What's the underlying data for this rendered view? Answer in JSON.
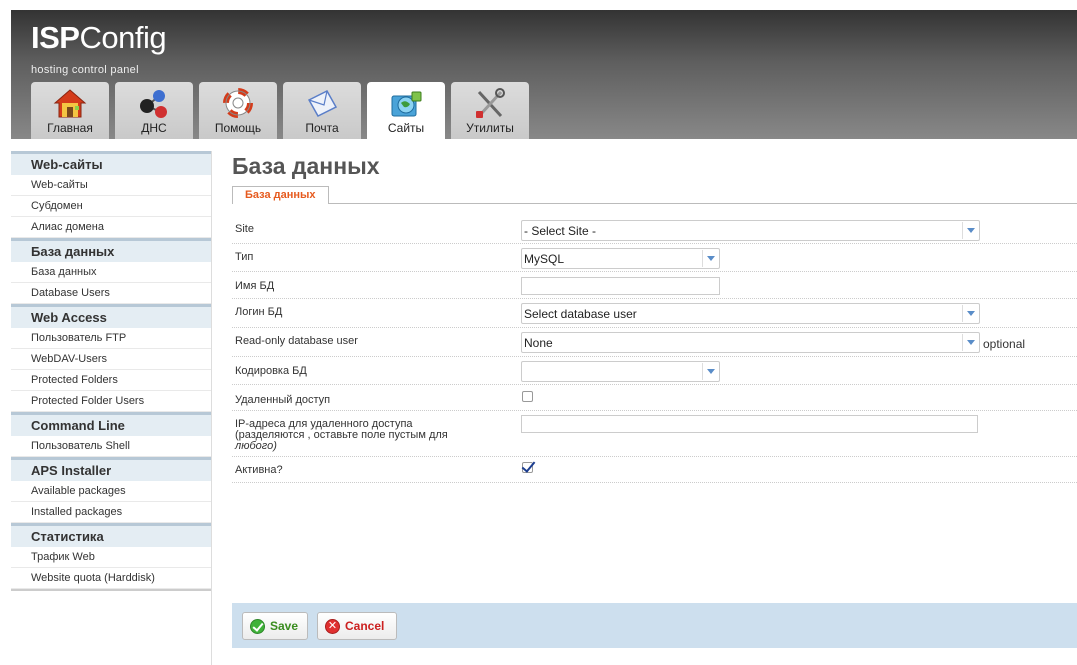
{
  "header": {
    "logo_bold": "ISP",
    "logo_rest": "Config",
    "tagline": "hosting control panel"
  },
  "tabs": [
    {
      "label": "Главная",
      "icon": "home-icon"
    },
    {
      "label": "ДНС",
      "icon": "dns-network-icon"
    },
    {
      "label": "Помощь",
      "icon": "help-lifebuoy-icon"
    },
    {
      "label": "Почта",
      "icon": "mail-envelope-icon"
    },
    {
      "label": "Сайты",
      "icon": "sites-globe-folder-icon",
      "active": true
    },
    {
      "label": "Утилиты",
      "icon": "tools-icon"
    }
  ],
  "sidebar": {
    "sections": [
      {
        "title": "Web-сайты",
        "items": [
          "Web-сайты",
          "Субдомен",
          "Алиас домена"
        ]
      },
      {
        "title": "База данных",
        "items": [
          "База данных",
          "Database Users"
        ]
      },
      {
        "title": "Web Access",
        "items": [
          "Пользователь FTP",
          "WebDAV-Users",
          "Protected Folders",
          "Protected Folder Users"
        ]
      },
      {
        "title": "Command Line",
        "items": [
          "Пользователь Shell"
        ]
      },
      {
        "title": "APS Installer",
        "items": [
          "Available packages",
          "Installed packages"
        ]
      },
      {
        "title": "Статистика",
        "items": [
          "Трафик Web",
          "Website quota (Harddisk)"
        ]
      }
    ]
  },
  "main": {
    "title": "База данных",
    "form_tab": "База данных",
    "fields": {
      "site": {
        "label": "Site",
        "value": "- Select Site -"
      },
      "type": {
        "label": "Тип",
        "value": "MySQL"
      },
      "db_name": {
        "label": "Имя БД",
        "value": ""
      },
      "db_login": {
        "label": "Логин БД",
        "value": "Select database user"
      },
      "ro_user": {
        "label": "Read-only database user",
        "value": "None",
        "hint": "optional"
      },
      "charset": {
        "label": "Кодировка БД",
        "value": ""
      },
      "remote_access": {
        "label": "Удаленный доступ",
        "checked": false
      },
      "remote_ips": {
        "label_line1": "IP-адреса для удаленного доступа",
        "label_line2": "(разделяются , оставьте поле пустым для",
        "label_line3": "любого)",
        "value": ""
      },
      "active": {
        "label": "Активна?",
        "checked": true
      }
    },
    "buttons": {
      "save": "Save",
      "cancel": "Cancel"
    }
  }
}
